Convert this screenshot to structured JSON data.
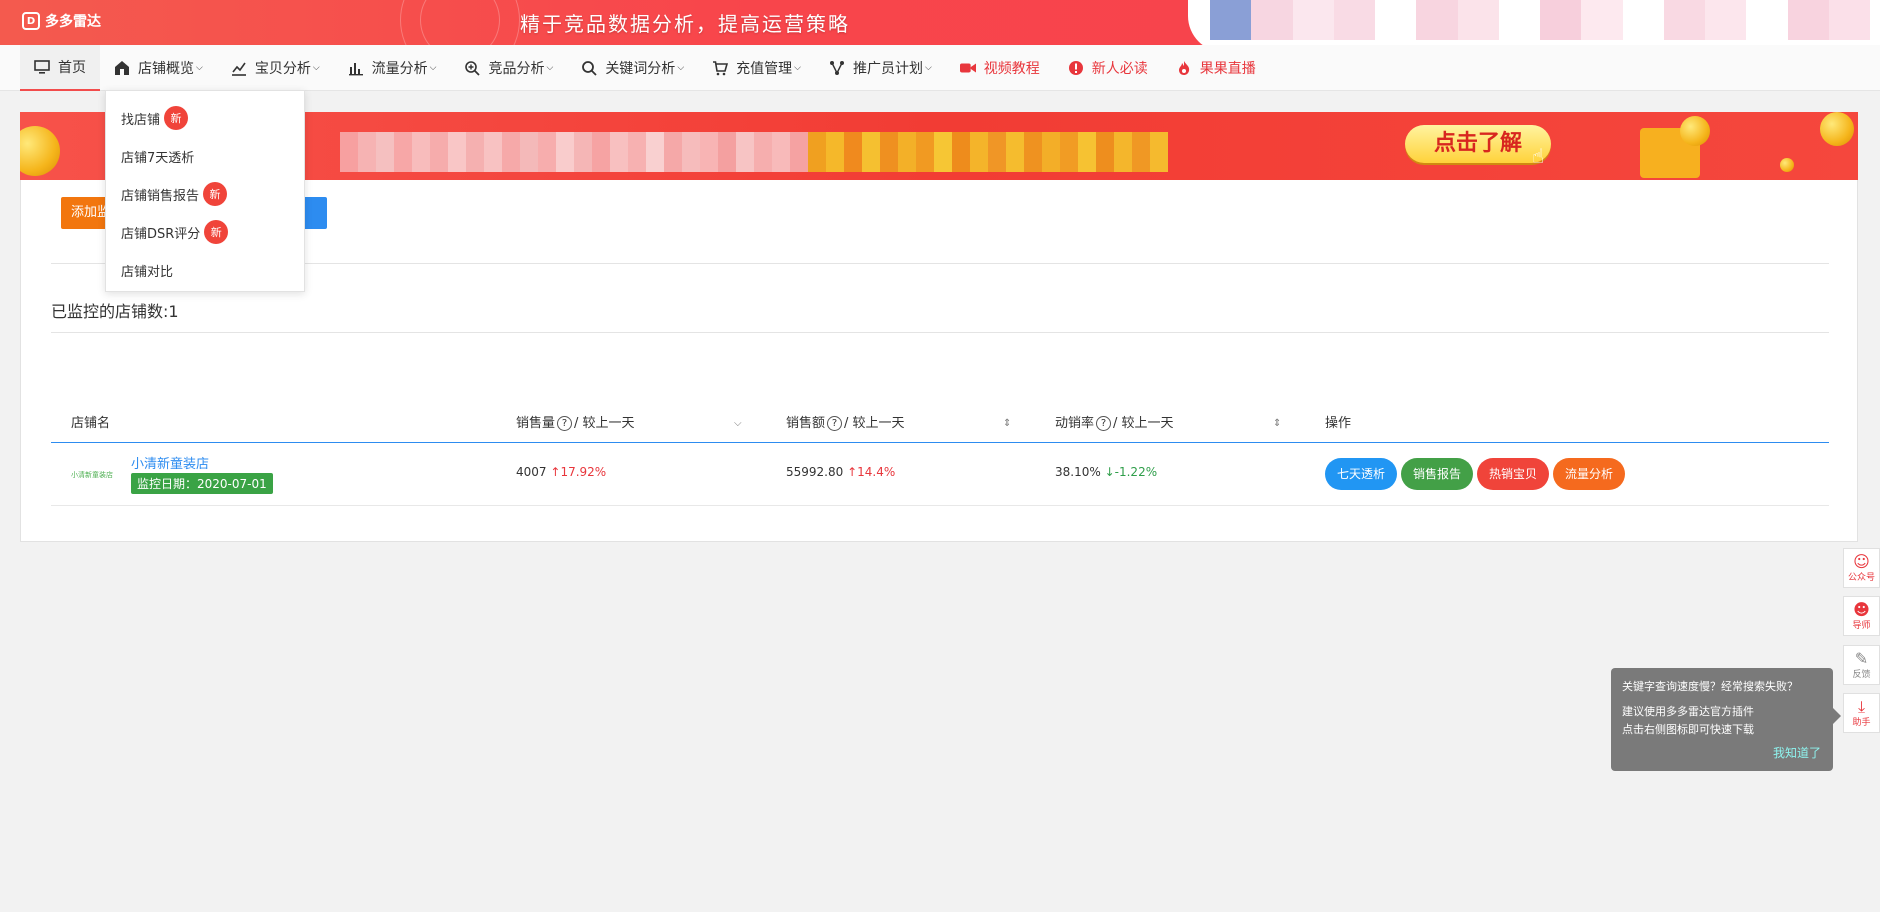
{
  "header": {
    "logo_text": "多多雷达",
    "slogan": "精于竞品数据分析，提高运营策略"
  },
  "nav": {
    "items": [
      {
        "label": "首页",
        "icon": "monitor-icon"
      },
      {
        "label": "店铺概览",
        "icon": "shop-icon"
      },
      {
        "label": "宝贝分析",
        "icon": "chart-line-icon"
      },
      {
        "label": "流量分析",
        "icon": "bar-chart-icon"
      },
      {
        "label": "竞品分析",
        "icon": "zoom-plus-icon"
      },
      {
        "label": "关键词分析",
        "icon": "search-icon"
      },
      {
        "label": "充值管理",
        "icon": "cart-icon"
      },
      {
        "label": "推广员计划",
        "icon": "network-icon"
      },
      {
        "label": "视频教程",
        "icon": "video-icon"
      },
      {
        "label": "新人必读",
        "icon": "alert-icon"
      },
      {
        "label": "果果直播",
        "icon": "fire-icon"
      }
    ]
  },
  "dropdown": {
    "items": [
      {
        "label": "找店铺",
        "badge": "新"
      },
      {
        "label": "店铺7天透析",
        "badge": ""
      },
      {
        "label": "店铺销售报告",
        "badge": "新"
      },
      {
        "label": "店铺DSR评分",
        "badge": "新"
      },
      {
        "label": "店铺对比",
        "badge": ""
      }
    ]
  },
  "promo": {
    "button_label": "点击了解"
  },
  "main": {
    "add_button_label": "添加监",
    "monitored_count_label": "已监控的店铺数:1"
  },
  "table": {
    "headers": {
      "shop_name": "店铺名",
      "sales_qty": "销售量",
      "sales_amount": "销售额",
      "sell_rate": "动销率",
      "compare_suffix": "/ 较上一天",
      "actions": "操作"
    },
    "rows": [
      {
        "logo_text": "小清新童装店",
        "shop_name": "小清新童装店",
        "monitor_date": "监控日期：2020-07-01",
        "sales_qty": "4007",
        "sales_qty_change": "17.92%",
        "sales_amount": "55992.80",
        "sales_amount_change": "14.4%",
        "sell_rate": "38.10%",
        "sell_rate_change": "-1.22%"
      }
    ],
    "actions": [
      {
        "label": "七天透析",
        "color": "#2196f3"
      },
      {
        "label": "销售报告",
        "color": "#43a047"
      },
      {
        "label": "热销宝贝",
        "color": "#f0443a"
      },
      {
        "label": "流量分析",
        "color": "#f56a1e"
      }
    ]
  },
  "float_toolbar": [
    {
      "label": "公众号",
      "icon": "wechat-icon"
    },
    {
      "label": "导师",
      "icon": "mentor-icon"
    },
    {
      "label": "反馈",
      "icon": "edit-icon"
    },
    {
      "label": "助手",
      "icon": "download-icon"
    }
  ],
  "tooltip": {
    "line1": "关键字查询速度慢？经常搜索失败？",
    "line2": "建议使用多多雷达官方插件",
    "line3": "点击右侧图标即可快速下载",
    "got_it": "我知道了"
  },
  "colors": {
    "brand_red": "#f8454b",
    "link_blue": "#2d8cf0",
    "up_red": "#e8363c",
    "down_green": "#2f9e4a"
  }
}
